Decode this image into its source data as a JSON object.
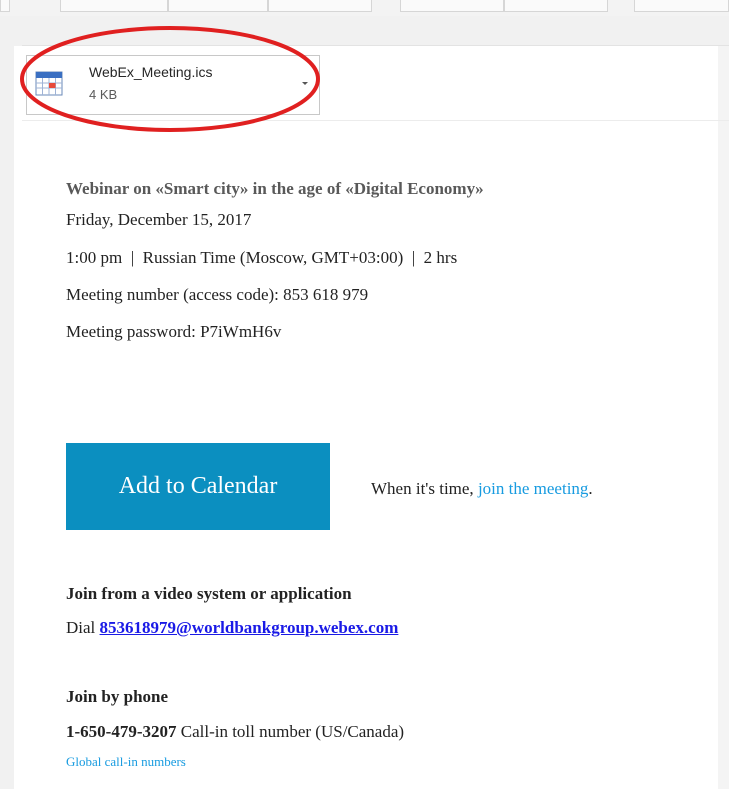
{
  "attachment": {
    "file_name": "WebEx_Meeting.ics",
    "file_size": "4 KB",
    "icon": "calendar-file-icon",
    "chevron_icon": "chevron-down-icon",
    "highlight_color": "#e02020"
  },
  "meeting": {
    "title": "Webinar on «Smart city» in the age of «Digital Economy»",
    "date": "Friday, December 15, 2017",
    "time": "1:00 pm  |  Russian Time (Moscow, GMT+03:00)  |  2 hrs",
    "number": "Meeting number (access code): 853 618 979",
    "password": "Meeting password: P7iWmH6v"
  },
  "actions": {
    "add_to_calendar": "Add to Calendar",
    "when_prefix": "When it's time,",
    "join_link": "join the meeting",
    "when_suffix": "."
  },
  "video": {
    "heading": "Join from a video system or application",
    "dial_label": "Dial",
    "dial_address": "853618979@worldbankgroup.webex.com"
  },
  "phone": {
    "heading": "Join by phone",
    "number": "1-650-479-3207",
    "number_desc": " Call-in toll number (US/Canada)",
    "global_link": "Global call-in numbers"
  },
  "colors": {
    "button_bg": "#0b8fc0",
    "link": "#179be0",
    "email_link": "#1a1ae6"
  }
}
